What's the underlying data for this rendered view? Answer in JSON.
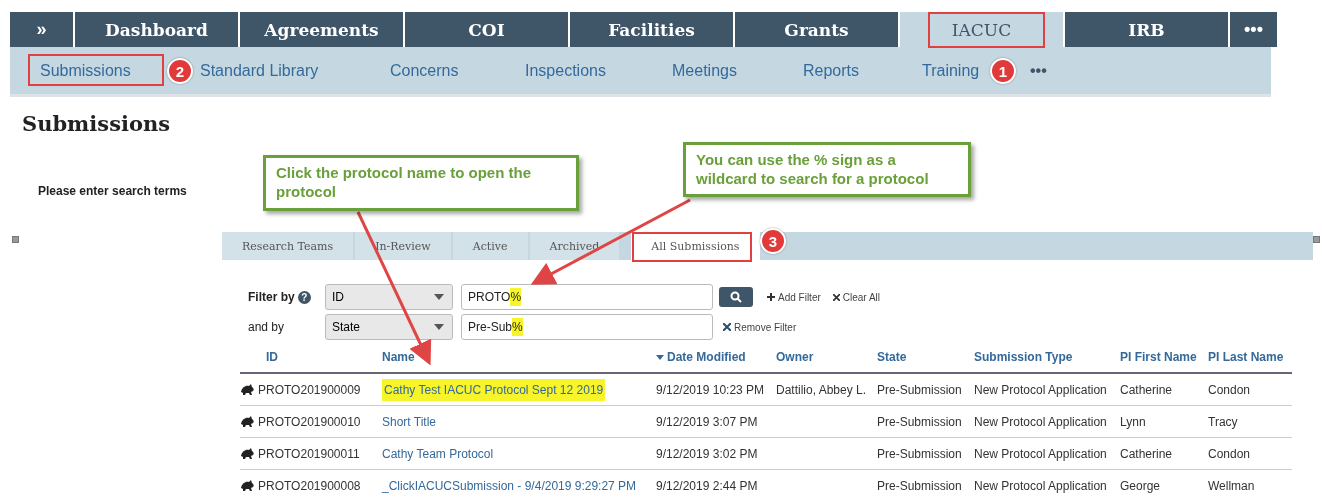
{
  "top_nav": {
    "expand_label": "»",
    "more_label": "•••",
    "tabs": [
      {
        "label": "Dashboard",
        "selected": false
      },
      {
        "label": "Agreements",
        "selected": false
      },
      {
        "label": "COI",
        "selected": false
      },
      {
        "label": "Facilities",
        "selected": false
      },
      {
        "label": "Grants",
        "selected": false
      },
      {
        "label": "IACUC",
        "selected": true
      },
      {
        "label": "IRB",
        "selected": false
      }
    ]
  },
  "sub_nav": {
    "items": [
      "Submissions",
      "Standard Library",
      "Concerns",
      "Inspections",
      "Meetings",
      "Reports",
      "Training"
    ],
    "more_label": "•••"
  },
  "page_title": "Submissions",
  "search_prompt": "Please enter search terms",
  "tabs": [
    {
      "label": "Research Teams",
      "selected": false
    },
    {
      "label": "In-Review",
      "selected": false
    },
    {
      "label": "Active",
      "selected": false
    },
    {
      "label": "Archived",
      "selected": false
    },
    {
      "label": "All Submissions",
      "selected": true
    }
  ],
  "filters": [
    {
      "label": "Filter by",
      "help": "?",
      "field": "ID",
      "value": "PROTO",
      "highlight": "%",
      "actions": [
        {
          "kind": "search"
        },
        {
          "kind": "add",
          "label": "Add Filter"
        },
        {
          "kind": "clear",
          "label": "Clear All"
        }
      ]
    },
    {
      "label": "and by",
      "field": "State",
      "value": "Pre-Sub",
      "highlight": "%",
      "actions": [
        {
          "kind": "remove",
          "label": "Remove Filter"
        }
      ]
    }
  ],
  "table": {
    "columns": [
      "ID",
      "Name",
      "Date Modified",
      "Owner",
      "State",
      "Submission Type",
      "PI First Name",
      "PI Last Name"
    ],
    "rows": [
      {
        "id": "PROTO201900009",
        "name": "Cathy Test IACUC Protocol Sept 12 2019",
        "highlighted": true,
        "date_modified": "9/12/2019 10:23 PM",
        "owner": "Dattilio, Abbey L.",
        "state": "Pre-Submission",
        "submission_type": "New Protocol Application",
        "pi_first_name": "Catherine",
        "pi_last_name": "Condon"
      },
      {
        "id": "PROTO201900010",
        "name": "Short Title",
        "highlighted": false,
        "date_modified": "9/12/2019 3:07 PM",
        "state": "Pre-Submission",
        "submission_type": "New Protocol Application",
        "pi_first_name": "Lynn",
        "pi_last_name": "Tracy"
      },
      {
        "id": "PROTO201900011",
        "name": "Cathy Team Protocol",
        "highlighted": false,
        "date_modified": "9/12/2019 3:02 PM",
        "state": "Pre-Submission",
        "submission_type": "New Protocol Application",
        "pi_first_name": "Catherine",
        "pi_last_name": "Condon"
      },
      {
        "id": "PROTO201900008",
        "name": "_ClickIACUCSubmission - 9/4/2019 9:29:27 PM",
        "highlighted": false,
        "date_modified": "9/12/2019 2:44 PM",
        "state": "Pre-Submission",
        "submission_type": "New Protocol Application",
        "pi_first_name": "George",
        "pi_last_name": "Wellman"
      }
    ]
  },
  "annotations": {
    "callouts": [
      {
        "text": "Click the protocol name to open the protocol"
      },
      {
        "text": "You can use the % sign as a wildcard to search for a protocol"
      }
    ],
    "badges": [
      "1",
      "2",
      "3"
    ]
  }
}
